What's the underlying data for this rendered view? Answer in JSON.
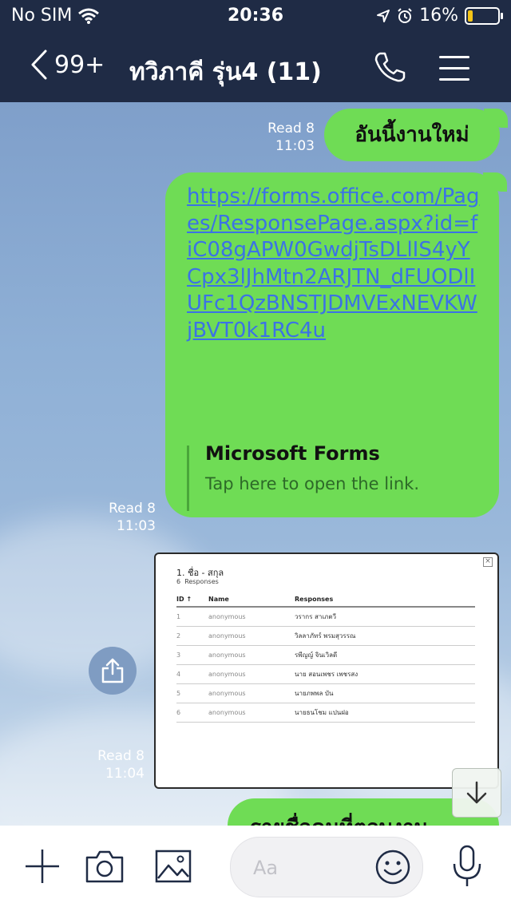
{
  "status_bar": {
    "carrier": "No SIM",
    "time": "20:36",
    "battery_percent": "16%"
  },
  "header": {
    "back_count": "99+",
    "title": "ทวิภาคี รุ่น4 (11)"
  },
  "messages": [
    {
      "read": "Read 8",
      "time": "11:03",
      "text": "อันนี้งานใหม่"
    },
    {
      "read": "Read 8",
      "time": "11:03",
      "link": "https://forms.office.com/Pages/ResponsePage.aspx?id=fiC08gAPW0GwdjTsDLlIS4yYCpx3lJhMtn2ARJTN_dFUODlIUFc1QzBNSTJDMVExNEVKWjBVT0k1RC4u",
      "preview_title": "Microsoft Forms",
      "preview_desc": "Tap here to open the link."
    },
    {
      "read": "Read 8",
      "time": "11:04",
      "image": {
        "question": "1. ชื่อ - สกุล",
        "count": "6",
        "count_label": "Responses",
        "columns": [
          "ID ↑",
          "Name",
          "Responses"
        ],
        "rows": [
          [
            "1",
            "anonymous",
            "วรากร สาเภตวี"
          ],
          [
            "2",
            "anonymous",
            "วิลลาภัทร์ พรมสุวรรณ"
          ],
          [
            "3",
            "anonymous",
            "รพีญญ์ จินเวิลดี"
          ],
          [
            "4",
            "anonymous",
            "นาย สอนเพชร เพชรสง"
          ],
          [
            "5",
            "anonymous",
            "นายภพพล บัน"
          ],
          [
            "6",
            "anonymous",
            "นายธนโชม แปนฝอ"
          ]
        ]
      }
    },
    {
      "text": "รายชื่อคนที่ตอบงาน"
    }
  ],
  "input": {
    "placeholder": "Aa"
  },
  "colors": {
    "header_bg": "#1f2b45",
    "bubble_green": "#6fdc55",
    "link_blue": "#3b72e6"
  },
  "icons": {
    "wifi": "wifi-icon",
    "location": "location-icon",
    "alarm": "alarm-icon",
    "phone": "phone-icon",
    "menu": "menu-icon",
    "share": "share-icon",
    "scroll_down": "arrow-down-icon",
    "plus": "plus-icon",
    "camera": "camera-icon",
    "image": "image-icon",
    "emoji": "emoji-icon",
    "mic": "microphone-icon"
  }
}
